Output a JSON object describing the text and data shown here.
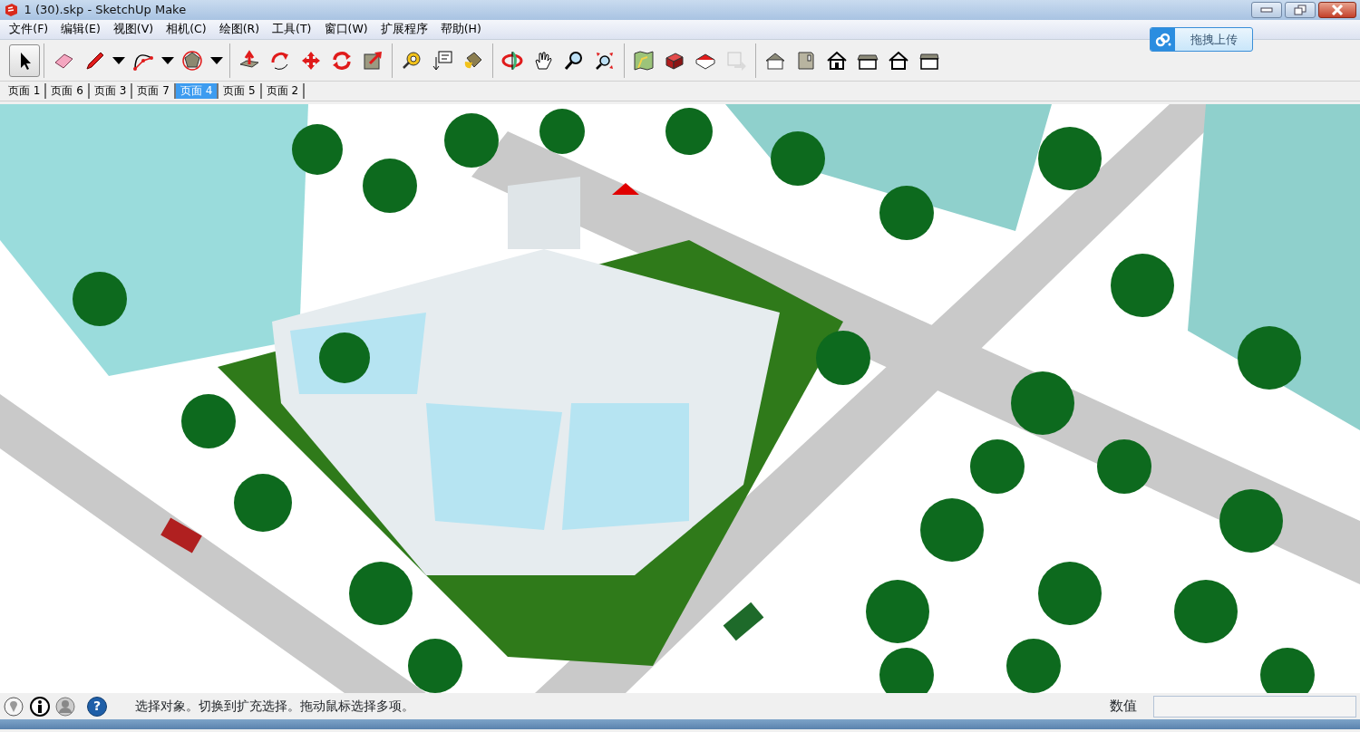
{
  "window": {
    "title": "1 (30).skp - SketchUp Make"
  },
  "menu": [
    "文件(F)",
    "编辑(E)",
    "视图(V)",
    "相机(C)",
    "绘图(R)",
    "工具(T)",
    "窗口(W)",
    "扩展程序",
    "帮助(H)"
  ],
  "upload_button": {
    "label": "拖拽上传"
  },
  "toolbar": {
    "groups": [
      [
        {
          "selected": true,
          "dropdown": false,
          "disabled": false
        }
      ],
      [
        {
          "selected": false,
          "dropdown": false,
          "disabled": false
        },
        {
          "selected": false,
          "dropdown": true,
          "disabled": false
        },
        {
          "selected": false,
          "dropdown": true,
          "disabled": false
        },
        {
          "selected": false,
          "dropdown": true,
          "disabled": false
        }
      ],
      [
        {
          "selected": false,
          "dropdown": false,
          "disabled": false
        },
        {
          "selected": false,
          "dropdown": false,
          "disabled": false
        },
        {
          "selected": false,
          "dropdown": false,
          "disabled": false
        },
        {
          "selected": false,
          "dropdown": false,
          "disabled": false
        },
        {
          "selected": false,
          "dropdown": false,
          "disabled": false
        }
      ],
      [
        {
          "selected": false,
          "dropdown": false,
          "disabled": false
        },
        {
          "selected": false,
          "dropdown": false,
          "disabled": false
        },
        {
          "selected": false,
          "dropdown": false,
          "disabled": false
        }
      ],
      [
        {
          "selected": false,
          "dropdown": false,
          "disabled": false
        },
        {
          "selected": false,
          "dropdown": false,
          "disabled": false
        },
        {
          "selected": false,
          "dropdown": false,
          "disabled": false
        },
        {
          "selected": false,
          "dropdown": false,
          "disabled": false
        }
      ],
      [
        {
          "selected": false,
          "dropdown": false,
          "disabled": false
        },
        {
          "selected": false,
          "dropdown": false,
          "disabled": false
        },
        {
          "selected": false,
          "dropdown": false,
          "disabled": false
        },
        {
          "selected": false,
          "dropdown": false,
          "disabled": true
        }
      ],
      [
        {
          "selected": false,
          "dropdown": false,
          "disabled": false
        },
        {
          "selected": false,
          "dropdown": false,
          "disabled": false
        },
        {
          "selected": false,
          "dropdown": false,
          "disabled": false
        },
        {
          "selected": false,
          "dropdown": false,
          "disabled": false
        },
        {
          "selected": false,
          "dropdown": false,
          "disabled": false
        },
        {
          "selected": false,
          "dropdown": false,
          "disabled": false
        }
      ]
    ]
  },
  "scene_tabs": [
    {
      "label": "页面 1",
      "selected": false
    },
    {
      "label": "页面 6",
      "selected": false
    },
    {
      "label": "页面 3",
      "selected": false
    },
    {
      "label": "页面 7",
      "selected": false
    },
    {
      "label": "页面 4",
      "selected": true
    },
    {
      "label": "页面 5",
      "selected": false
    },
    {
      "label": "页面 2",
      "selected": false
    }
  ],
  "status_bar": {
    "help_glyph": "?",
    "message": "选择对象。切换到扩充选择。拖动鼠标选择多项。",
    "measurement_label": "数值"
  }
}
